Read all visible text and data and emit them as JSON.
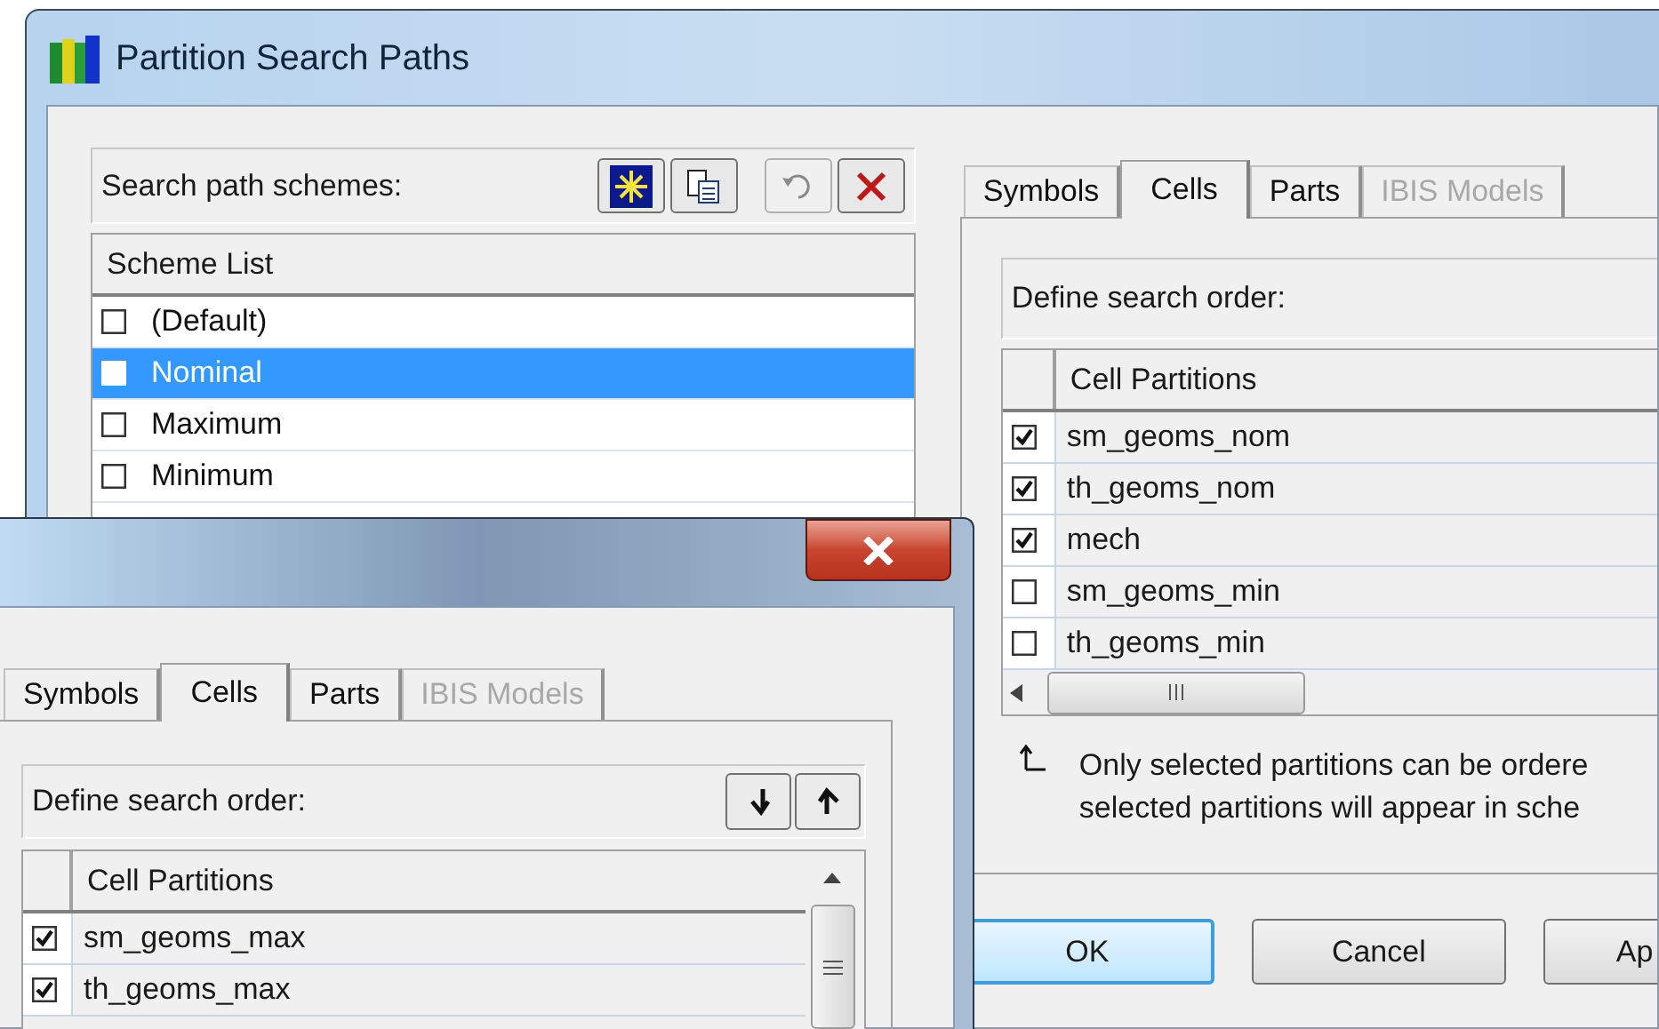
{
  "main_window": {
    "title": "Partition Search Paths",
    "schemes": {
      "label": "Search path schemes:",
      "column": "Scheme List",
      "items": [
        {
          "label": "(Default)",
          "checked": false,
          "selected": false
        },
        {
          "label": "Nominal",
          "checked": false,
          "selected": true
        },
        {
          "label": "Maximum",
          "checked": false,
          "selected": false
        },
        {
          "label": "Minimum",
          "checked": false,
          "selected": false
        }
      ]
    },
    "tabs": [
      {
        "label": "Symbols",
        "selected": false,
        "disabled": false
      },
      {
        "label": "Cells",
        "selected": true,
        "disabled": false
      },
      {
        "label": "Parts",
        "selected": false,
        "disabled": false
      },
      {
        "label": "IBIS Models",
        "selected": false,
        "disabled": true
      }
    ],
    "search_order": {
      "label": "Define search order:",
      "column": "Cell Partitions",
      "rows": [
        {
          "label": "sm_geoms_nom",
          "checked": true
        },
        {
          "label": "th_geoms_nom",
          "checked": true
        },
        {
          "label": "mech",
          "checked": true
        },
        {
          "label": "sm_geoms_min",
          "checked": false
        },
        {
          "label": "th_geoms_min",
          "checked": false
        }
      ]
    },
    "note": [
      "Only selected partitions can be ordere",
      "selected partitions will appear in sche"
    ],
    "buttons": [
      {
        "label": "OK",
        "default": true
      },
      {
        "label": "Cancel",
        "default": false
      },
      {
        "label": "Ap",
        "default": false
      }
    ]
  },
  "front_window": {
    "tabs": [
      {
        "label": "Symbols",
        "selected": false,
        "disabled": false
      },
      {
        "label": "Cells",
        "selected": true,
        "disabled": false
      },
      {
        "label": "Parts",
        "selected": false,
        "disabled": false
      },
      {
        "label": "IBIS Models",
        "selected": false,
        "disabled": true
      }
    ],
    "search_order": {
      "label": "Define search order:",
      "column": "Cell Partitions",
      "rows": [
        {
          "label": "sm_geoms_max",
          "checked": true
        },
        {
          "label": "th_geoms_max",
          "checked": true
        }
      ]
    }
  }
}
